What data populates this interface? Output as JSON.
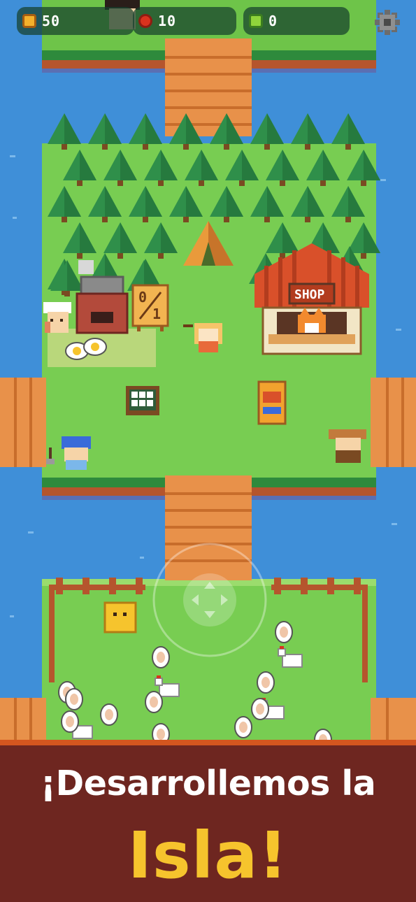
{
  "hud": {
    "coins": {
      "icon": "coin-icon",
      "value": "50"
    },
    "apples": {
      "icon": "apple-icon",
      "value": "10"
    },
    "gems": {
      "icon": "gem-icon",
      "value": "0"
    },
    "settings_icon": "gear-icon"
  },
  "scene": {
    "shop_sign": "SHOP",
    "quest_board_top": "0",
    "quest_board_bottom": "1"
  },
  "promo": {
    "line1": "¡Desarrollemos la",
    "line2": "Isla!"
  },
  "colors": {
    "water": "#3f8fd8",
    "grass": "#78cd52",
    "footer_bg": "#6e2620",
    "footer_accent": "#d4561f",
    "headline_yellow": "#f6c42d"
  }
}
